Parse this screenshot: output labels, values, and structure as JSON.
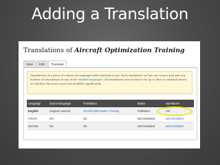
{
  "slide": {
    "title": "Adding a Translation"
  },
  "page": {
    "heading_prefix": "Translations of",
    "heading_node": "Aircraft Optimization Training"
  },
  "tabs": [
    {
      "label": "View"
    },
    {
      "label": "Edit"
    },
    {
      "label": "Translate"
    }
  ],
  "notice": {
    "part1": "Translations of a piece of content are managed with translation sets. Each translation set has one source post and any number of translations in any of the ",
    "link": "enabled languages",
    "part2": ". All translations are tracked to be up to date or outdated based on whether the source post was modified significantly."
  },
  "table": {
    "headers": [
      "Language",
      "Source language",
      "Translation",
      "Status",
      "Operations"
    ],
    "rows": [
      {
        "language": "English",
        "source": "(original content)",
        "translation": "Aircraft Optimization Training",
        "status": "Published",
        "operation": "edit"
      },
      {
        "language": "French",
        "source": "n/a",
        "translation": "n/a",
        "status": "Not translated",
        "operation": "add translation"
      },
      {
        "language": "German",
        "source": "n/a",
        "translation": "n/a",
        "status": "Not translated",
        "operation": "add translation"
      }
    ]
  },
  "colors": {
    "highlight": "#f2ea1f",
    "link": "#2b6fb6",
    "table_header_bg": "#4a4a4a"
  }
}
